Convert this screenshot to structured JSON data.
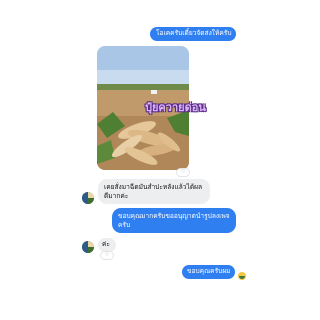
{
  "messages": {
    "m1": "โอเคครับเดี๋ยวจัดส่งให้ครับ",
    "photo_caption": "ปุ๋ยควายด่อน",
    "m2": "เคยสั่งมาฉีดมันสำปะหลังแล้วได้ผลดีมากค่ะ",
    "m3": "ขอบคุณมากครับขออนุญาตนำรูปลงเพจครับ",
    "m4": "ค่ะ",
    "m5": "ขอบคุณครับผม"
  },
  "colors": {
    "outgoing_bubble": "#2f7ff1",
    "incoming_bubble": "#eceef0",
    "caption_text": "#d9b5f5"
  },
  "icons": {
    "reaction": "like-reaction-icon",
    "avatar": "contact-avatar",
    "read_receipt": "seen-avatar-icon"
  }
}
